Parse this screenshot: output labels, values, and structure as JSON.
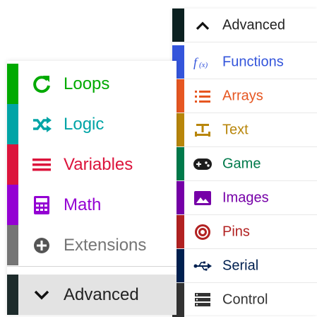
{
  "left_toolbox": {
    "items": [
      {
        "label": "Loops",
        "icon": "refresh-icon",
        "color": "#00aa00"
      },
      {
        "label": "Logic",
        "icon": "shuffle-icon",
        "color": "#00a4a6"
      },
      {
        "label": "Variables",
        "icon": "list-icon",
        "color": "#dc143c"
      },
      {
        "label": "Math",
        "icon": "calculator-icon",
        "color": "#9400d3"
      },
      {
        "label": "Extensions",
        "icon": "plus-circle-icon",
        "color": "#757575"
      }
    ],
    "advanced": {
      "label": "Advanced",
      "icon": "chevron-down-icon",
      "color": "#1d2b2b"
    }
  },
  "right_toolbox": {
    "advanced": {
      "label": "Advanced",
      "icon": "chevron-up-icon",
      "color": "#0b2020"
    },
    "items": [
      {
        "label": "Functions",
        "icon": "function-icon",
        "color": "#3455db"
      },
      {
        "label": "Arrays",
        "icon": "list-icon",
        "color": "#e65722"
      },
      {
        "label": "Text",
        "icon": "text-icon",
        "color": "#b8860b"
      },
      {
        "label": "Game",
        "icon": "gamepad-icon",
        "color": "#007a4b"
      },
      {
        "label": "Images",
        "icon": "image-icon",
        "color": "#7600a8"
      },
      {
        "label": "Pins",
        "icon": "target-icon",
        "color": "#b22222"
      },
      {
        "label": "Serial",
        "icon": "usb-icon",
        "color": "#002050"
      },
      {
        "label": "Control",
        "icon": "server-icon",
        "color": "#333333"
      }
    ]
  }
}
